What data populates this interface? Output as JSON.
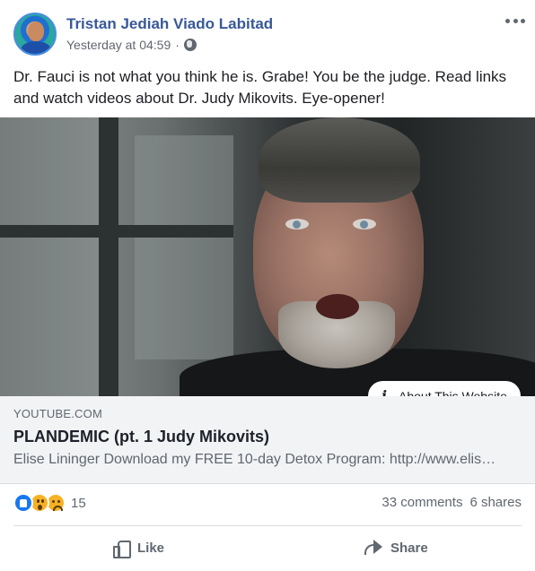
{
  "post": {
    "author": "Tristan Jediah Viado Labitad",
    "timestamp": "Yesterday at 04:59",
    "privacy_icon": "globe-icon",
    "options_icon": "more-options-icon",
    "text_line1": "Dr. Fauci is not what you think he is. Grabe! You be the judge. Read links",
    "text_line2": "and watch videos about Dr. Judy Mikovits. Eye-opener!"
  },
  "media": {
    "about_label": "About This Website",
    "info_icon_glyph": "i"
  },
  "link_preview": {
    "domain": "YOUTUBE.COM",
    "title": "PLANDEMIC (pt. 1 Judy Mikovits)",
    "description": "Elise Lininger Download my FREE 10-day Detox Program: http://www.elis…"
  },
  "engagement": {
    "reaction_icons": [
      "like-reaction-icon",
      "wow-reaction-icon",
      "sad-reaction-icon"
    ],
    "reaction_count": "15",
    "comments": "33 comments",
    "shares": "6 shares"
  },
  "actions": {
    "like_label": "Like",
    "share_label": "Share"
  },
  "colors": {
    "author_link": "#385898",
    "secondary_text": "#606770",
    "link_preview_bg": "#f2f3f5",
    "like_blue": "#1877f2",
    "reaction_yellow": "#f7b125"
  }
}
